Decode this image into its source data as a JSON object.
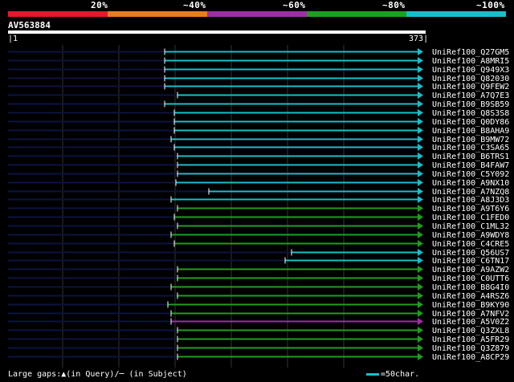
{
  "identity_legend": {
    "labels": [
      "20%",
      "~40%",
      "~60%",
      "~80%",
      "~100%"
    ],
    "colors": [
      "#e8172c",
      "#e87c22",
      "#9e2ea6",
      "#1f9e1f",
      "#17bfc9"
    ]
  },
  "query": {
    "name": "AV563884",
    "start": "1",
    "end": "373"
  },
  "hits": [
    {
      "name": "UniRef100_Q27GM5",
      "start": 205,
      "color": "#17bfc9"
    },
    {
      "name": "UniRef100_A8MRI5",
      "start": 205,
      "color": "#17bfc9"
    },
    {
      "name": "UniRef100_Q949X3",
      "start": 205,
      "color": "#17bfc9"
    },
    {
      "name": "UniRef100_Q82030",
      "start": 205,
      "color": "#17bfc9"
    },
    {
      "name": "UniRef100_Q9FEW2",
      "start": 205,
      "color": "#17bfc9"
    },
    {
      "name": "UniRef100_A7Q7E3",
      "start": 221,
      "color": "#17bfc9"
    },
    {
      "name": "UniRef100_B9SB59",
      "start": 205,
      "color": "#17bfc9"
    },
    {
      "name": "UniRef100_Q8S3S8",
      "start": 217,
      "color": "#17bfc9"
    },
    {
      "name": "UniRef100_Q0DY86",
      "start": 217,
      "color": "#17bfc9"
    },
    {
      "name": "UniRef100_B8AHA9",
      "start": 217,
      "color": "#17bfc9"
    },
    {
      "name": "UniRef100_B9MW72",
      "start": 213,
      "color": "#17bfc9"
    },
    {
      "name": "UniRef100_C3SA65",
      "start": 217,
      "color": "#17bfc9"
    },
    {
      "name": "UniRef100_B6TRS1",
      "start": 221,
      "color": "#17bfc9"
    },
    {
      "name": "UniRef100_B4FAW7",
      "start": 221,
      "color": "#17bfc9"
    },
    {
      "name": "UniRef100_C5Y092",
      "start": 221,
      "color": "#17bfc9"
    },
    {
      "name": "UniRef100_A9NX10",
      "start": 219,
      "color": "#17bfc9"
    },
    {
      "name": "UniRef100_A7NZQ8",
      "start": 260,
      "color": "#17bfc9"
    },
    {
      "name": "UniRef100_A8J3D3",
      "start": 213,
      "color": "#17bfc9"
    },
    {
      "name": "UniRef100_A9T6Y6",
      "start": 221,
      "color": "#1f9e1f"
    },
    {
      "name": "UniRef100_C1FED0",
      "start": 217,
      "color": "#1f9e1f"
    },
    {
      "name": "UniRef100_C1ML32",
      "start": 221,
      "color": "#1f9e1f"
    },
    {
      "name": "UniRef100_A9WDY8",
      "start": 213,
      "color": "#1f9e1f"
    },
    {
      "name": "UniRef100_C4CRE5",
      "start": 217,
      "color": "#1f9e1f"
    },
    {
      "name": "UniRef100_Q56US7",
      "start": 363,
      "color": "#17bfc9"
    },
    {
      "name": "UniRef100_C6TN17",
      "start": 355,
      "color": "#17bfc9"
    },
    {
      "name": "UniRef100_A9AZW2",
      "start": 221,
      "color": "#1f9e1f"
    },
    {
      "name": "UniRef100_C0UTT6",
      "start": 221,
      "color": "#1f9e1f"
    },
    {
      "name": "UniRef100_B8G4I0",
      "start": 213,
      "color": "#1f9e1f"
    },
    {
      "name": "UniRef100_A4RSZ6",
      "start": 221,
      "color": "#1f9e1f"
    },
    {
      "name": "UniRef100_B9KY90",
      "start": 209,
      "color": "#1f9e1f"
    },
    {
      "name": "UniRef100_A7NFV2",
      "start": 213,
      "color": "#1f9e1f"
    },
    {
      "name": "UniRef100_A5V0Z2",
      "start": 213,
      "color": "#9e2ea6"
    },
    {
      "name": "UniRef100_Q3ZXL8",
      "start": 221,
      "color": "#1f9e1f"
    },
    {
      "name": "UniRef100_A5FR29",
      "start": 221,
      "color": "#1f9e1f"
    },
    {
      "name": "UniRef100_Q3Z879",
      "start": 221,
      "color": "#1f9e1f"
    },
    {
      "name": "UniRef100_A8CP29",
      "start": 221,
      "color": "#1f9e1f"
    }
  ],
  "footer": {
    "gaps_text": "Large gaps:▲(in Query)/─ (in Subject)",
    "scale_text": "=50char."
  }
}
